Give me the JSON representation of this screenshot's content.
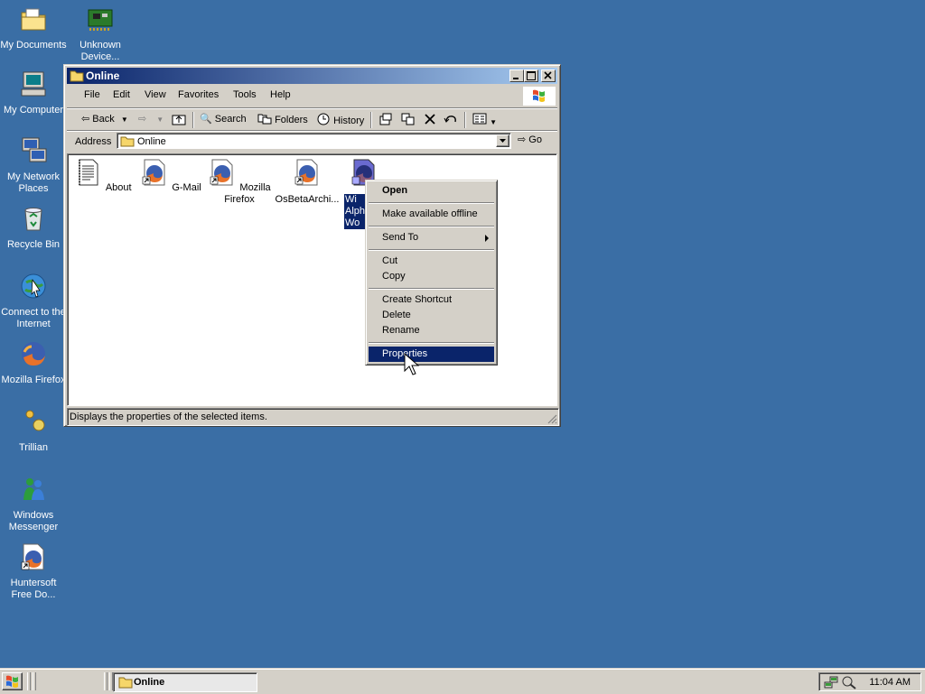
{
  "desktop": {
    "icons": [
      {
        "label": "My Documents",
        "icon": "my-documents-folder-icon"
      },
      {
        "label": "Unknown Device...",
        "icon": "circuit-board-icon"
      },
      {
        "label": "My Computer",
        "icon": "my-computer-icon"
      },
      {
        "label": "My Network Places",
        "icon": "network-places-icon"
      },
      {
        "label": "Recycle Bin",
        "icon": "recycle-bin-icon"
      },
      {
        "label": "Connect to the Internet",
        "icon": "connect-internet-icon"
      },
      {
        "label": "Mozilla Firefox",
        "icon": "firefox-icon"
      },
      {
        "label": "Trillian",
        "icon": "trillian-icon"
      },
      {
        "label": "Windows Messenger",
        "icon": "messenger-icon"
      },
      {
        "label": "Huntersoft Free Do...",
        "icon": "firefox-shortcut-icon"
      }
    ],
    "background_color": "#3a6ea5"
  },
  "window": {
    "title": "Online",
    "menu": [
      "File",
      "Edit",
      "View",
      "Favorites",
      "Tools",
      "Help"
    ],
    "toolbar": {
      "back": "Back",
      "search": "Search",
      "folders": "Folders",
      "history": "History"
    },
    "address": {
      "label": "Address",
      "value": "Online",
      "go": "Go"
    },
    "files": [
      {
        "label": "About",
        "icon": "text-document-icon"
      },
      {
        "label": "G-Mail",
        "icon": "firefox-shortcut-icon"
      },
      {
        "label": "Mozilla Firefox",
        "icon": "firefox-shortcut-icon"
      },
      {
        "label": "OsBetaArchi...",
        "icon": "firefox-shortcut-icon"
      },
      {
        "label": "Windows Alpha Wo...",
        "lines": [
          "Wi",
          "Alph",
          "Wo"
        ],
        "icon": "firefox-shortcut-icon",
        "selected": true
      }
    ],
    "status": "Displays the properties of the selected items."
  },
  "context_menu": {
    "items": [
      "Open",
      "Make available offline",
      "Send To",
      "Cut",
      "Copy",
      "Create Shortcut",
      "Delete",
      "Rename",
      "Properties"
    ],
    "highlighted": "Properties"
  },
  "taskbar": {
    "task": "Online",
    "clock": "11:04 AM"
  },
  "colors": {
    "titlebar_start": "#0a246a",
    "titlebar_end": "#a6caf0",
    "selection": "#0a246a",
    "face": "#d4d0c8"
  }
}
